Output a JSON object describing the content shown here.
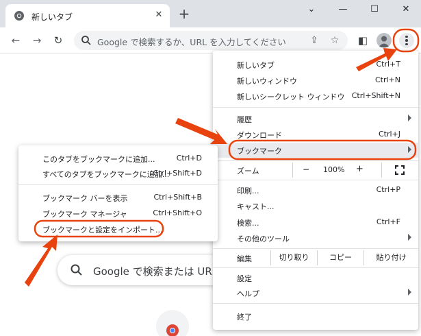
{
  "tab": {
    "title": "新しいタブ",
    "close_glyph": "✕",
    "new_tab_glyph": "+"
  },
  "window": {
    "minimize": "—",
    "maximize": "☐",
    "close": "✕",
    "dropdown": "⌄"
  },
  "toolbar": {
    "back": "←",
    "forward": "→",
    "reload": "↻",
    "omnibox_placeholder": "Google で検索するか、URL を入力してください",
    "share": "⇪",
    "bookmark_star": "☆",
    "side_panel": "◧"
  },
  "page": {
    "search_placeholder": "Google で検索または UR"
  },
  "colors": {
    "accent": "#e8430e",
    "menu_highlight": "#e8eaed"
  },
  "main_menu": {
    "new_tab": {
      "label": "新しいタブ",
      "shortcut": "Ctrl+T"
    },
    "new_window": {
      "label": "新しいウィンドウ",
      "shortcut": "Ctrl+N"
    },
    "new_incognito": {
      "label": "新しいシークレット ウィンドウ",
      "shortcut": "Ctrl+Shift+N"
    },
    "history": {
      "label": "履歴"
    },
    "downloads": {
      "label": "ダウンロード",
      "shortcut": "Ctrl+J"
    },
    "bookmarks": {
      "label": "ブックマーク"
    },
    "zoom": {
      "label": "ズーム",
      "minus": "−",
      "value": "100%",
      "plus": "+",
      "fullscreen": "⛶"
    },
    "print": {
      "label": "印刷...",
      "shortcut": "Ctrl+P"
    },
    "cast": {
      "label": "キャスト..."
    },
    "find": {
      "label": "検索...",
      "shortcut": "Ctrl+F"
    },
    "more_tools": {
      "label": "その他のツール"
    },
    "edit": {
      "label": "編集",
      "cut": "切り取り",
      "copy": "コピー",
      "paste": "貼り付け"
    },
    "settings": {
      "label": "設定"
    },
    "help": {
      "label": "ヘルプ"
    },
    "exit": {
      "label": "終了"
    }
  },
  "bookmark_submenu": {
    "bookmark_tab": {
      "label": "このタブをブックマークに追加...",
      "shortcut": "Ctrl+D"
    },
    "bookmark_all_tabs": {
      "label": "すべてのタブをブックマークに追加...",
      "shortcut": "Ctrl+Shift+D"
    },
    "show_bar": {
      "label": "ブックマーク バーを表示",
      "shortcut": "Ctrl+Shift+B"
    },
    "manager": {
      "label": "ブックマーク マネージャ",
      "shortcut": "Ctrl+Shift+O"
    },
    "import": {
      "label": "ブックマークと設定をインポート..."
    }
  }
}
